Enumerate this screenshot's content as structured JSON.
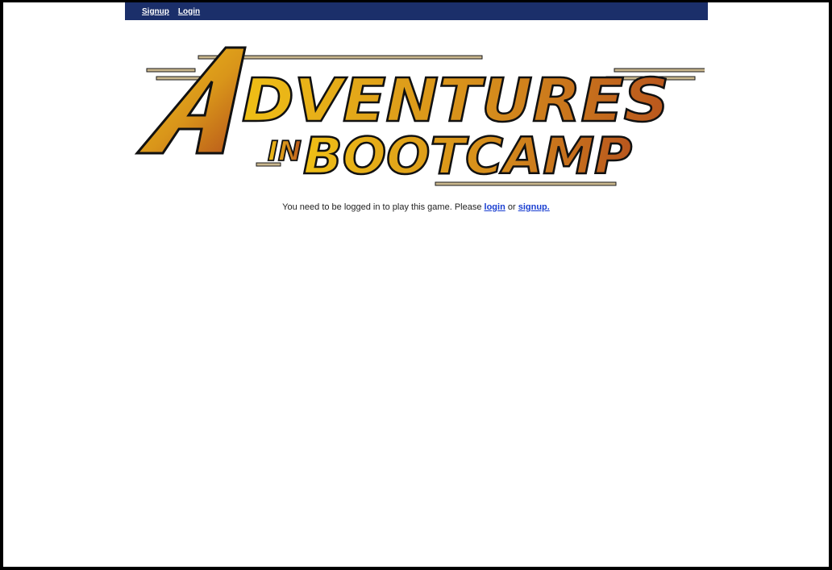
{
  "nav": {
    "signup_label": "Signup",
    "login_label": "Login"
  },
  "logo": {
    "line1": "ADVENTURES",
    "line2_small": "IN",
    "line2_big": "BOOTCAMP"
  },
  "message": {
    "prefix": "You need to be logged in to play this game. Please ",
    "login_link": "login",
    "middle": " or ",
    "signup_link": "signup."
  },
  "colors": {
    "navbar_bg": "#1b2f6a",
    "link": "#1a3fd1",
    "logo_gold": "#e3a713",
    "logo_orange": "#b5521b"
  }
}
